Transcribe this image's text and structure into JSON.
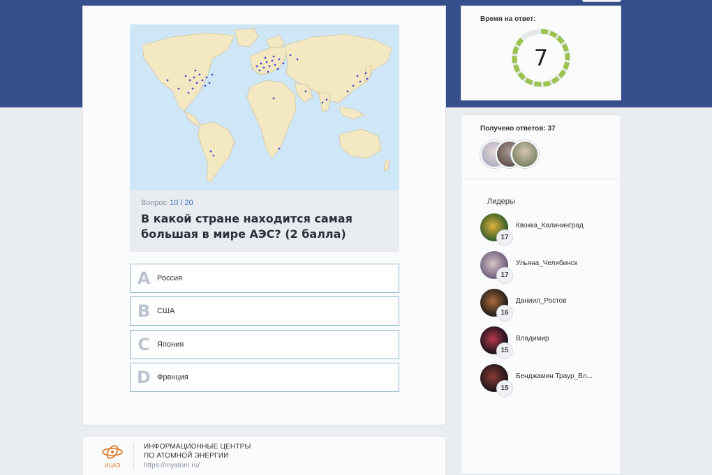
{
  "quiz": {
    "question_label": "Вопрос",
    "question_number": "10 / 20",
    "question_text": "В какой стране находится самая большая в мире АЭС? (2 балла)",
    "answers": [
      {
        "letter": "A",
        "label": "Россия"
      },
      {
        "letter": "B",
        "label": "США"
      },
      {
        "letter": "C",
        "label": "Япония"
      },
      {
        "letter": "D",
        "label": "Фрвнция"
      }
    ]
  },
  "footer": {
    "logo_text": "ИЦАЭ",
    "title_line1": "ИНФОРМАЦИОННЫЕ ЦЕНТРЫ",
    "title_line2": "ПО АТОМНОЙ ЭНЕРГИИ",
    "url": "https://myatom.ru/"
  },
  "timer": {
    "label": "Время на ответ:",
    "value": "7",
    "remaining_fraction": 0.9,
    "ring_color": "#9cc24f"
  },
  "responses": {
    "label": "Получено ответов:",
    "count": "37"
  },
  "leaders": {
    "title": "Лидеры",
    "items": [
      {
        "name": "Квокка_Калининград",
        "score": "17"
      },
      {
        "name": "Ульяна_Челябинск",
        "score": "17"
      },
      {
        "name": "Даниил_Ростов",
        "score": "16"
      },
      {
        "name": "Владимир",
        "score": "15"
      },
      {
        "name": "Бенджамин Траур_Вл...",
        "score": "15"
      }
    ]
  },
  "colors": {
    "header_band": "#354f8d",
    "accent_blue": "#3d6fb6",
    "answer_border": "#8db9ce",
    "logo_orange": "#e07b2a"
  }
}
